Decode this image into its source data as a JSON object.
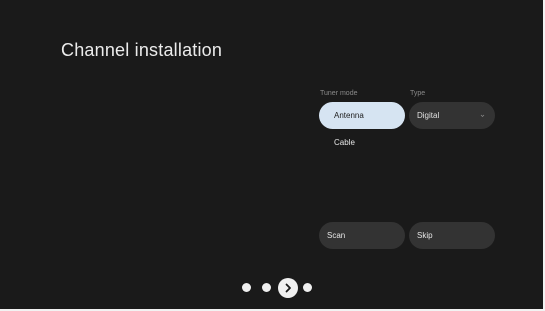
{
  "page": {
    "title": "Channel installation"
  },
  "tuner_mode": {
    "label": "Tuner mode",
    "options": [
      {
        "label": "Antenna",
        "selected": true
      },
      {
        "label": "Cable",
        "selected": false
      }
    ]
  },
  "type": {
    "label": "Type",
    "selected_value": "Digital",
    "icon": "chevron-down-icon"
  },
  "actions": {
    "scan_label": "Scan",
    "skip_label": "Skip"
  },
  "pager": {
    "total_steps": 4,
    "current_step": 3,
    "next_icon": "chevron-right-icon"
  },
  "colors": {
    "background": "#1a1a1a",
    "selected_pill": "#d6e4f2",
    "pill": "#333333"
  }
}
